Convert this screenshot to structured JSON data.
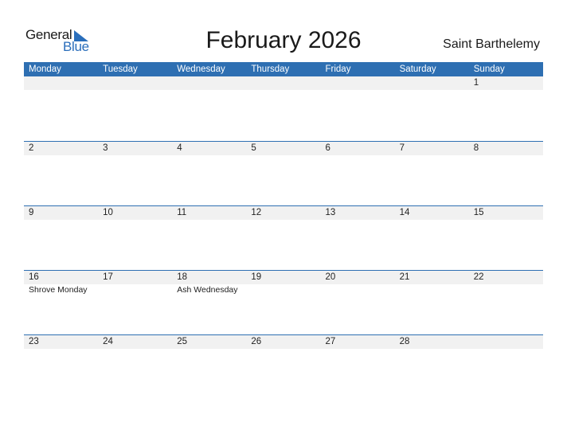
{
  "logo": {
    "general": "General",
    "blue": "Blue",
    "icon": "triangle-flag-icon"
  },
  "title": "February 2026",
  "country": "Saint Barthelemy",
  "colors": {
    "accent": "#2e6fb2",
    "band": "#f1f1f1",
    "logo_blue": "#2a6ebb"
  },
  "weekdays": [
    "Monday",
    "Tuesday",
    "Wednesday",
    "Thursday",
    "Friday",
    "Saturday",
    "Sunday"
  ],
  "weeks": [
    [
      {
        "day": "",
        "event": ""
      },
      {
        "day": "",
        "event": ""
      },
      {
        "day": "",
        "event": ""
      },
      {
        "day": "",
        "event": ""
      },
      {
        "day": "",
        "event": ""
      },
      {
        "day": "",
        "event": ""
      },
      {
        "day": "1",
        "event": ""
      }
    ],
    [
      {
        "day": "2",
        "event": ""
      },
      {
        "day": "3",
        "event": ""
      },
      {
        "day": "4",
        "event": ""
      },
      {
        "day": "5",
        "event": ""
      },
      {
        "day": "6",
        "event": ""
      },
      {
        "day": "7",
        "event": ""
      },
      {
        "day": "8",
        "event": ""
      }
    ],
    [
      {
        "day": "9",
        "event": ""
      },
      {
        "day": "10",
        "event": ""
      },
      {
        "day": "11",
        "event": ""
      },
      {
        "day": "12",
        "event": ""
      },
      {
        "day": "13",
        "event": ""
      },
      {
        "day": "14",
        "event": ""
      },
      {
        "day": "15",
        "event": ""
      }
    ],
    [
      {
        "day": "16",
        "event": "Shrove Monday"
      },
      {
        "day": "17",
        "event": ""
      },
      {
        "day": "18",
        "event": "Ash Wednesday"
      },
      {
        "day": "19",
        "event": ""
      },
      {
        "day": "20",
        "event": ""
      },
      {
        "day": "21",
        "event": ""
      },
      {
        "day": "22",
        "event": ""
      }
    ],
    [
      {
        "day": "23",
        "event": ""
      },
      {
        "day": "24",
        "event": ""
      },
      {
        "day": "25",
        "event": ""
      },
      {
        "day": "26",
        "event": ""
      },
      {
        "day": "27",
        "event": ""
      },
      {
        "day": "28",
        "event": ""
      },
      {
        "day": "",
        "event": ""
      }
    ]
  ]
}
